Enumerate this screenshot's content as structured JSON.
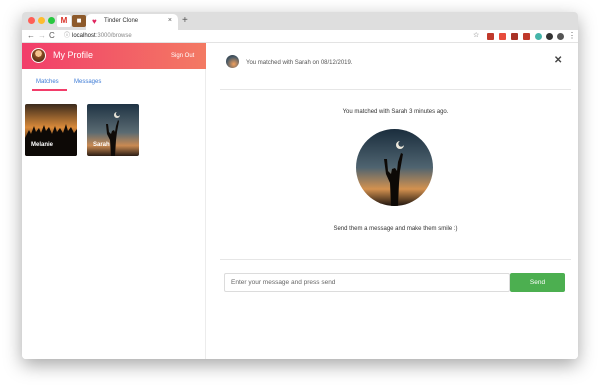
{
  "browser": {
    "tab_title": "Tinder Clone",
    "tab_close": "×",
    "new_tab": "+",
    "nav_back": "←",
    "nav_forward": "→",
    "nav_reload": "C",
    "info_icon": "ⓘ",
    "url_host": "localhost",
    "url_path": ":3000/browse",
    "bookmark_star": "☆",
    "menu": "⋮",
    "pinned_gmail": "M",
    "pinned_bag": "■",
    "extension_colors": [
      "#c0392b",
      "#e74c3c",
      "#a93226",
      "#c0392b",
      "#45b5aa",
      "#333333",
      "#555555"
    ]
  },
  "sidebar": {
    "title": "My Profile",
    "sign_out": "Sign Out",
    "tabs": [
      {
        "label": "Matches",
        "active": true
      },
      {
        "label": "Messages",
        "active": false
      }
    ],
    "matches": [
      {
        "name": "Melanie",
        "photo": "crowd-silhouette"
      },
      {
        "name": "Sarah",
        "photo": "woman-sky-silhouette"
      }
    ]
  },
  "main": {
    "header_text": "You matched with Sarah on 08/12/2019.",
    "close_icon": "✕",
    "matched_ago": "You matched with Sarah 3 minutes ago.",
    "cta": "Send them a message and make them smile :)",
    "message_placeholder": "Enter your message and press send",
    "message_value": "",
    "send_label": "Send"
  },
  "colors": {
    "header_gradient_start": "#f23d6a",
    "header_gradient_end": "#f37a63",
    "tab_link": "#3d7bd6",
    "send_button": "#4caf50"
  }
}
